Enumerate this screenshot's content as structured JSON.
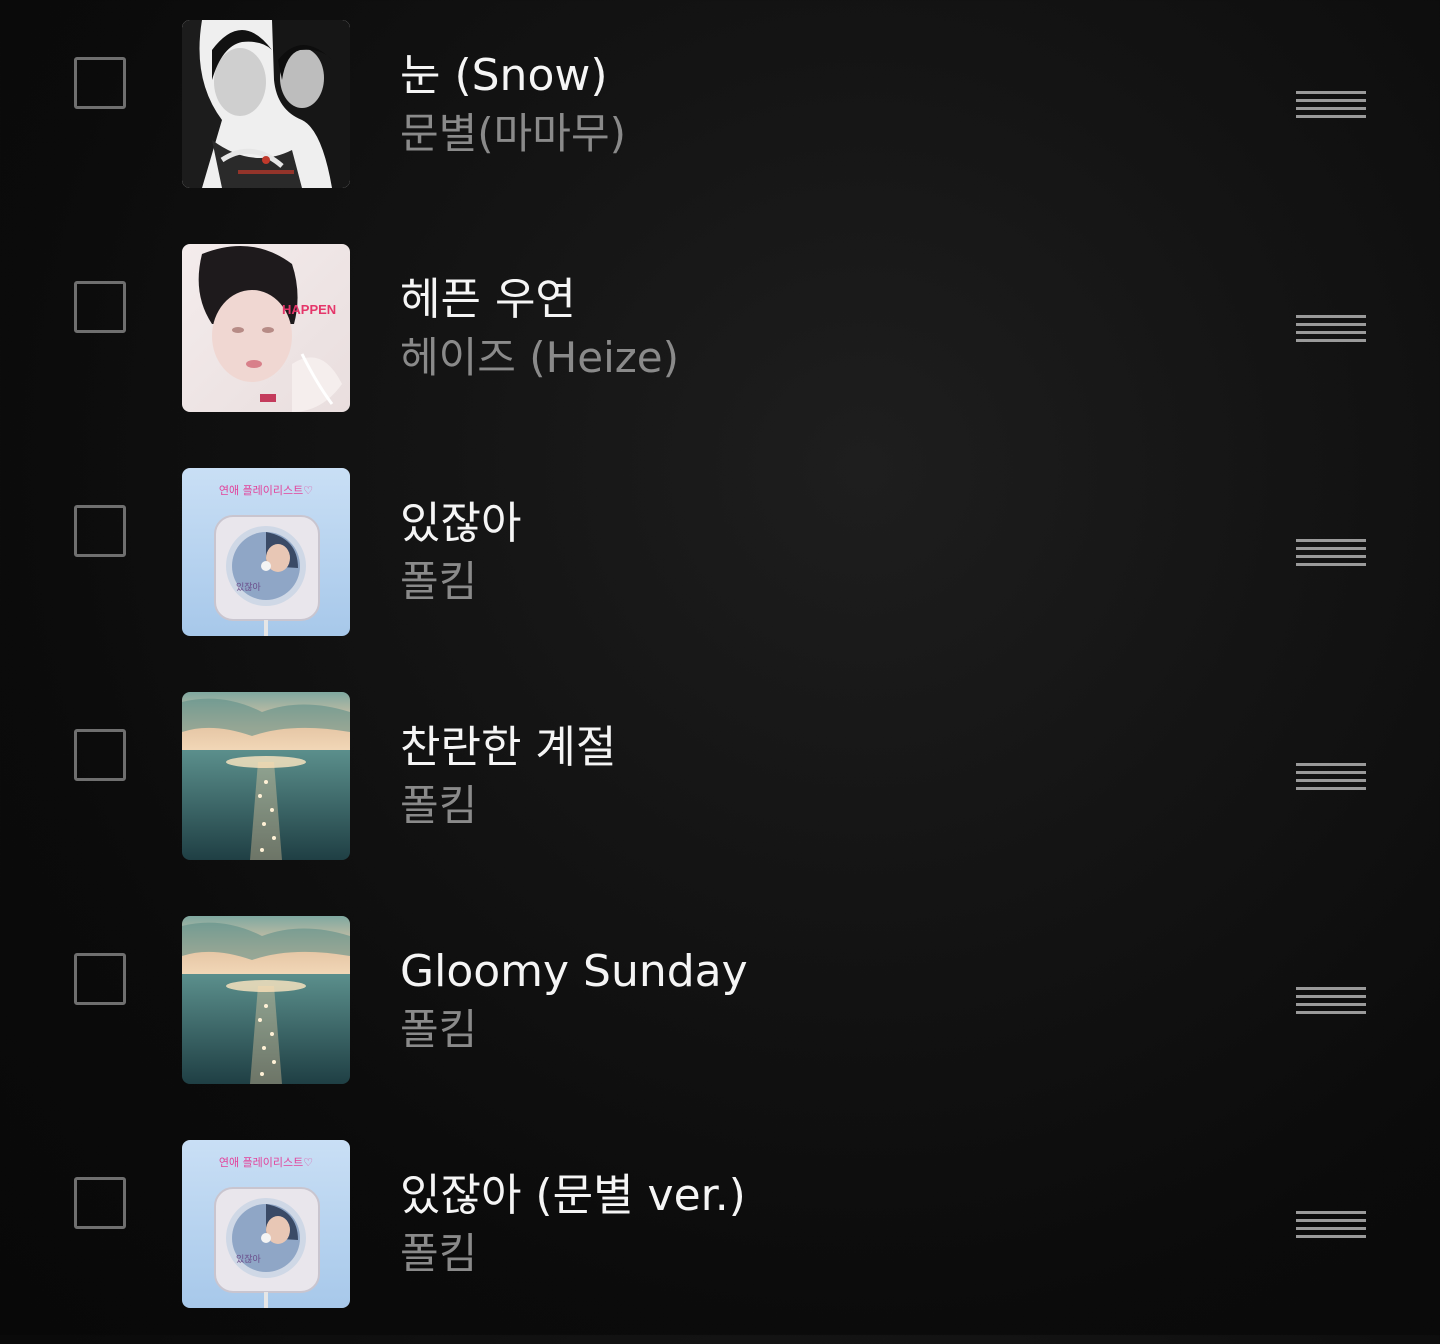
{
  "tracks": [
    {
      "title": "눈 (Snow)",
      "artist": "문별(마마무)",
      "art_icon": "album-art-bw-duo-icon"
    },
    {
      "title": "헤픈 우연",
      "artist": "헤이즈 (Heize)",
      "art_icon": "album-art-happen-icon",
      "art_text": "HAPPEN"
    },
    {
      "title": "있잖아",
      "artist": "폴킴",
      "art_icon": "album-art-cd-player-icon",
      "art_text": "연애 플레이리스트♡",
      "art_sub": "있잖아"
    },
    {
      "title": "찬란한 계절",
      "artist": "폴킴",
      "art_icon": "album-art-sea-sunset-icon"
    },
    {
      "title": "Gloomy Sunday",
      "artist": "폴킴",
      "art_icon": "album-art-sea-sunset-icon"
    },
    {
      "title": "있잖아 (문별 ver.)",
      "artist": "폴킴",
      "art_icon": "album-art-cd-player-icon",
      "art_text": "연애 플레이리스트♡",
      "art_sub": "있잖아"
    }
  ],
  "colors": {
    "title": "#f5f5f5",
    "artist": "#8a8a8a",
    "checkbox_border": "#6f6f6f",
    "handle": "#9a9a9a"
  }
}
